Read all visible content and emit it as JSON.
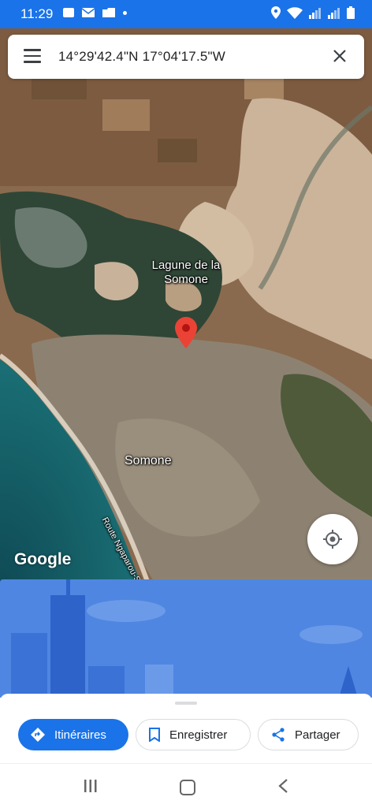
{
  "status_bar": {
    "time": "11:29",
    "icons": [
      "image-icon",
      "mail-icon",
      "folder-icon",
      "dot-icon",
      "location-icon",
      "wifi-icon",
      "signal-icon",
      "signal-icon",
      "battery-icon"
    ]
  },
  "search": {
    "coordinates": "14°29'42.4\"N 17°04'17.5\"W"
  },
  "map": {
    "labels": {
      "lagoon": "Lagune de la Somone",
      "town": "Somone",
      "road": "Route Ngaparou-Somone"
    },
    "logo": "Google",
    "pin_color": "#ea4335"
  },
  "actions": {
    "directions": "Itinéraires",
    "save": "Enregistrer",
    "share": "Partager"
  },
  "colors": {
    "accent": "#1a73e8",
    "panel": "#4f86e2"
  }
}
